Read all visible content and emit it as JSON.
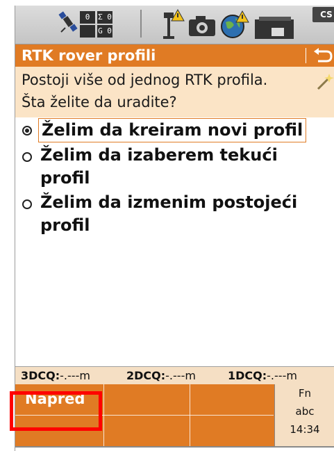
{
  "status_bar": {
    "counters": [
      "0",
      "Σ 0",
      "",
      "G 0"
    ],
    "cs_label": "CS"
  },
  "title_bar": {
    "title": "RTK rover profili"
  },
  "prompt": {
    "text_line1": "Postoji više od jednog RTK profila.",
    "text_line2": "Šta želite da uradite?"
  },
  "options": [
    {
      "label": "Želim da kreiram novi profil",
      "checked": true
    },
    {
      "label": "Želim da izaberem tekući profil",
      "checked": false
    },
    {
      "label": "Želim da izmenim postojeći profil",
      "checked": false
    }
  ],
  "cq_bar": {
    "label_3d": "3DCQ:",
    "value_3d": "-.---m",
    "label_2d": "2DCQ:",
    "value_2d": "-.---m",
    "label_1d": "1DCQ:",
    "value_1d": "-.---m"
  },
  "softkeys": {
    "f1": "Napred",
    "fn_label": "Fn",
    "input_mode": "abc",
    "time": "14:34"
  },
  "colors": {
    "accent": "#e07b24",
    "prompt_bg": "#fbe4c6",
    "highlight": "#ff0000"
  }
}
